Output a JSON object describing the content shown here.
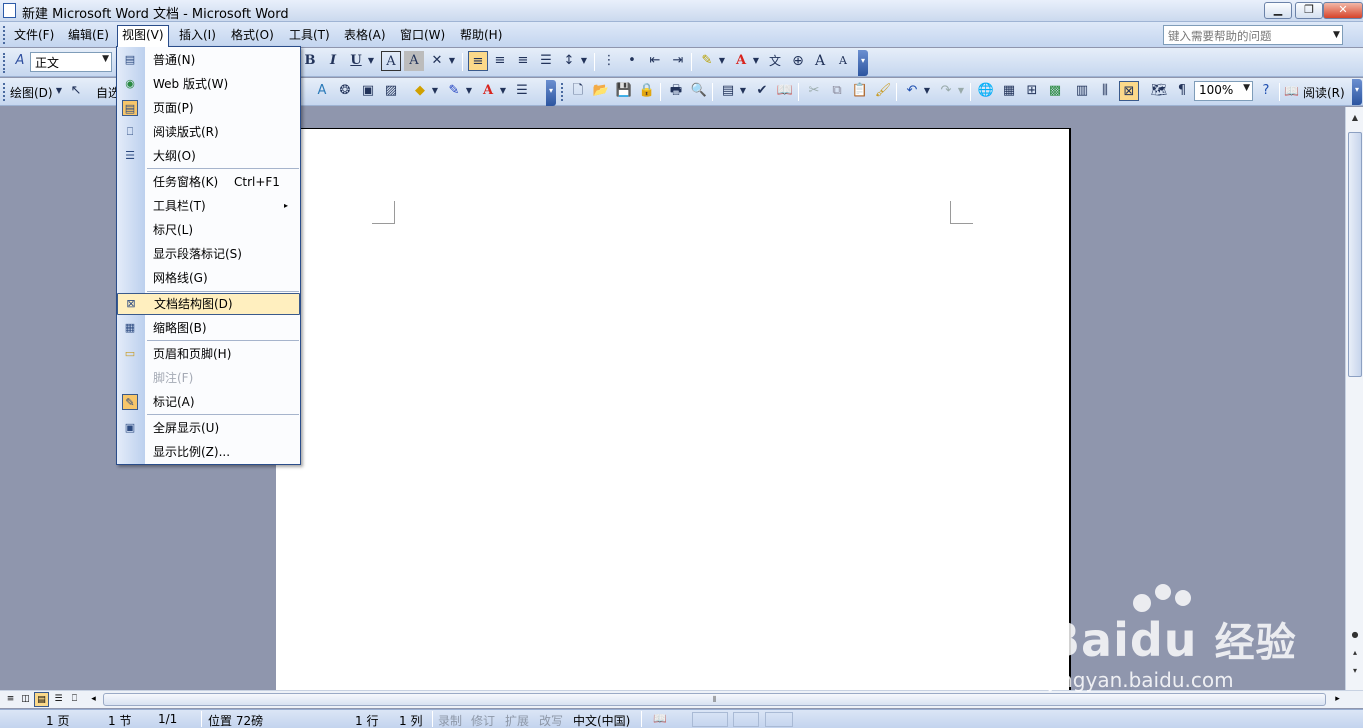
{
  "window": {
    "title": "新建 Microsoft Word 文档 - Microsoft Word",
    "min_label": "▁",
    "restore_label": "❐",
    "close_label": "✕"
  },
  "menubar": {
    "items": [
      "文件(F)",
      "编辑(E)",
      "视图(V)",
      "插入(I)",
      "格式(O)",
      "工具(T)",
      "表格(A)",
      "窗口(W)",
      "帮助(H)"
    ],
    "active_index": 2,
    "help_placeholder": "键入需要帮助的问题"
  },
  "formatting_toolbar": {
    "style_value": "正文",
    "bold": "B",
    "italic": "I",
    "underline": "U",
    "char_border": "A",
    "char_shading": "A",
    "asian_layout": "文",
    "grow_font": "A",
    "shrink_font": "A"
  },
  "drawing_toolbar": {
    "draw_label": "绘图(D)",
    "autoshapes_label": "自选",
    "zoom_value": "100%",
    "read_label": "阅读(R)"
  },
  "view_menu": {
    "items": [
      {
        "label": "普通(N)",
        "icon": "normal-view-icon"
      },
      {
        "label": "Web 版式(W)",
        "icon": "web-layout-icon"
      },
      {
        "label": "页面(P)",
        "icon": "print-layout-icon",
        "checked": true
      },
      {
        "label": "阅读版式(R)",
        "icon": "reading-layout-icon"
      },
      {
        "label": "大纲(O)",
        "icon": "outline-icon"
      },
      {
        "label": "任务窗格(K)",
        "shortcut": "Ctrl+F1"
      },
      {
        "label": "工具栏(T)",
        "submenu": "▸"
      },
      {
        "label": "标尺(L)"
      },
      {
        "label": "显示段落标记(S)"
      },
      {
        "label": "网格线(G)"
      },
      {
        "label": "文档结构图(D)",
        "icon": "document-map-icon",
        "highlighted": true
      },
      {
        "label": "缩略图(B)",
        "icon": "thumbnails-icon"
      },
      {
        "label": "页眉和页脚(H)",
        "icon": "header-footer-icon"
      },
      {
        "label": "脚注(F)",
        "disabled": true
      },
      {
        "label": "标记(A)",
        "icon": "markup-icon",
        "checked": true
      },
      {
        "label": "全屏显示(U)",
        "icon": "full-screen-icon"
      },
      {
        "label": "显示比例(Z)..."
      }
    ]
  },
  "statusbar": {
    "page": "1 页",
    "section": "1 节",
    "page_of": "1/1",
    "position": "位置 72磅",
    "line": "1 行",
    "column": "1 列",
    "rec": "录制",
    "trk": "修订",
    "ext": "扩展",
    "ovr": "改写",
    "language": "中文(中国)"
  },
  "watermark": {
    "brand": "Bai",
    "brand2": "du",
    "suffix": "经验",
    "url": "jingyan.baidu.com"
  },
  "colors": {
    "accent": "#2a4d8a",
    "highlight": "#ffefbf",
    "workspace": "#8f96ad",
    "font_color_red": "#d8241e",
    "highlight_yellow": "#f5e000"
  }
}
